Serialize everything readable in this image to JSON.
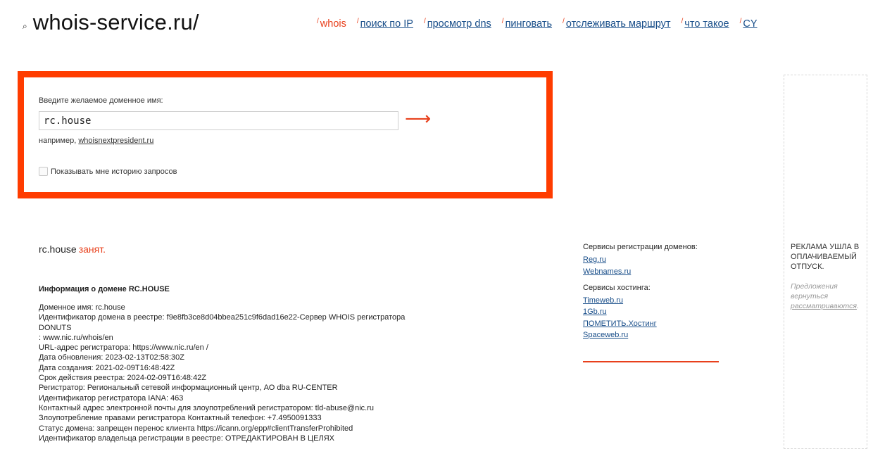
{
  "header": {
    "logo_text": "whois-service.ru/",
    "logo_icon": "magnifier-icon",
    "nav": [
      {
        "label": "whois",
        "active": true
      },
      {
        "label": "поиск по IP",
        "active": false
      },
      {
        "label": "просмотр dns",
        "active": false
      },
      {
        "label": "пинговать",
        "active": false
      },
      {
        "label": "отслеживать маршрут",
        "active": false
      },
      {
        "label": "что такое",
        "active": false
      },
      {
        "label": "CY",
        "active": false
      }
    ]
  },
  "search": {
    "label": "Введите желаемое доменное имя:",
    "value": "rc.house",
    "submit_icon": "arrow-right-icon",
    "example_prefix": "например,",
    "example_link": "whoisnextpresident.ru",
    "history_label": "Показывать мне историю запросов",
    "history_checked": false
  },
  "result": {
    "domain": "rc.house",
    "status": "занят.",
    "info_title": "Информация о домене RC.HOUSE",
    "lines": [
      "Доменное имя: rc.house",
      "Идентификатор домена в реестре: f9e8fb3ce8d04bbea251c9f6dad16e22-Сервер WHOIS регистратора DONUTS",
      ": www.nic.ru/whois/en",
      "URL-адрес регистратора: https://www.nic.ru/en /",
      "Дата обновления: 2023-02-13T02:58:30Z",
      "Дата создания: 2021-02-09T16:48:42Z",
      "Срок действия реестра: 2024-02-09T16:48:42Z",
      "Регистратор: Региональный сетевой информационный центр, АО dba RU-CENTER",
      "Идентификатор регистратора IANA: 463",
      "Контактный адрес электронной почты для злоупотреблений регистратором: tld-abuse@nic.ru",
      "Злоупотребление правами регистратора Контактный телефон: +7.4950091333",
      "Статус домена: запрещен перенос клиента https://icann.org/epp#clientTransferProhibited",
      "Идентификатор владельца регистрации в реестре: ОТРЕДАКТИРОВАН В ЦЕЛЯХ"
    ]
  },
  "services": {
    "registration_title": "Сервисы регистрации доменов:",
    "registration_links": [
      "Reg.ru",
      "Webnames.ru"
    ],
    "hosting_title": "Сервисы хостинга:",
    "hosting_links": [
      "Timeweb.ru",
      "1Gb.ru",
      "ПОМЕТИТЬ.Хостинг",
      "Spaceweb.ru"
    ]
  },
  "ad": {
    "title": "РЕКЛАМА УШЛА В ОПЛАЧИВАЕМЫЙ ОТПУСК.",
    "text_prefix": "Предложения вернуться",
    "text_link": "рассматриваются",
    "text_suffix": "."
  },
  "colors": {
    "accent": "#ff3c00",
    "link": "#1a4f8a"
  }
}
